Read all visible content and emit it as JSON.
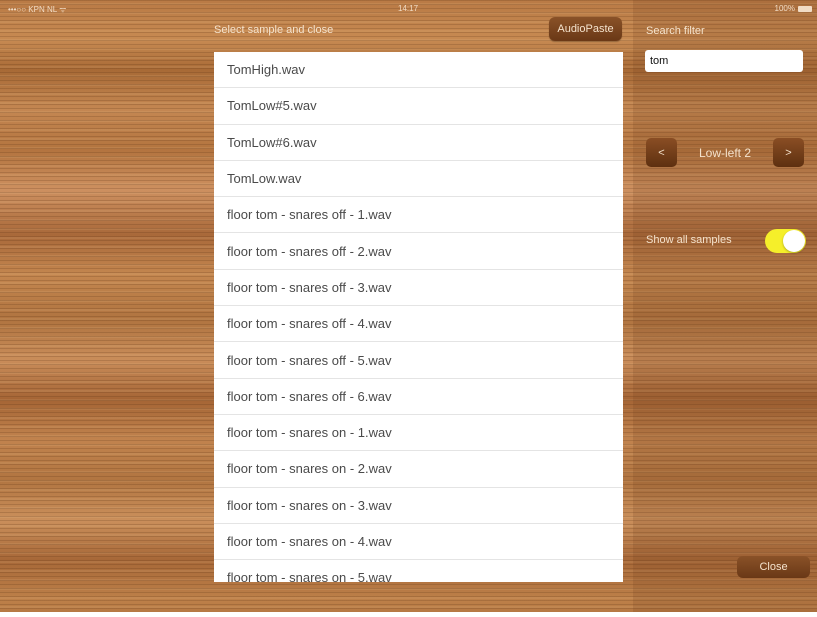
{
  "status_bar": {
    "carrier": "•••○○ KPN NL ᯤ",
    "time": "14:17",
    "battery": "100%"
  },
  "header": {
    "title": "Select sample and close",
    "audiopaste_label": "AudioPaste"
  },
  "samples": [
    "TomHigh.wav",
    "TomLow#5.wav",
    "TomLow#6.wav",
    "TomLow.wav",
    "floor tom - snares off - 1.wav",
    "floor tom - snares off - 2.wav",
    "floor tom - snares off - 3.wav",
    "floor tom - snares off - 4.wav",
    "floor tom - snares off - 5.wav",
    "floor tom - snares off - 6.wav",
    "floor tom - snares on - 1.wav",
    "floor tom - snares on - 2.wav",
    "floor tom - snares on - 3.wav",
    "floor tom - snares on - 4.wav",
    "floor tom - snares on - 5.wav"
  ],
  "search": {
    "label": "Search filter",
    "value": "tom"
  },
  "navigator": {
    "prev_label": "<",
    "current": "Low-left 2",
    "next_label": ">"
  },
  "show_all": {
    "label": "Show all samples",
    "enabled": true
  },
  "close_label": "Close",
  "colors": {
    "toggle_on": "#f5ef2a",
    "button_brown": "#6a3816",
    "list_bg": "#ffffff"
  }
}
